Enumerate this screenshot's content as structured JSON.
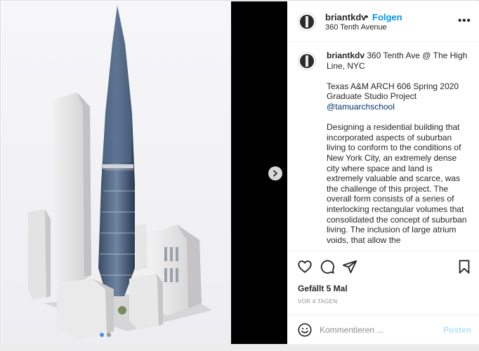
{
  "header": {
    "username": "briantkdv",
    "separator": "•",
    "follow_label": "Folgen",
    "location": "360 Tenth Avenue",
    "more_label": "•••"
  },
  "caption": {
    "username": "briantkdv",
    "line1": " 360 Tenth Ave @ The High Line, NYC",
    "para2": "Texas A&M ARCH 606 Spring 2020 Graduate Studio Project",
    "mention": "@tamuarchschool",
    "para3": "Designing a residential building that incorporated aspects of suburban living to conform to the conditions of New York City, an extremely dense city where space and land is extremely valuable and scarce, was the challenge of this project. The overall form consists of a series of interlocking rectangular volumes that consolidated the concept of suburban living. The inclusion of large atrium voids, that allow the"
  },
  "actions": {
    "likes": "Gefällt 5 Mal",
    "time": "VOR 4 TAGEN"
  },
  "comment": {
    "placeholder": "Kommentieren ...",
    "post_label": "Posten"
  },
  "carousel": {
    "count": 2,
    "active_index": 0
  },
  "colors": {
    "accent": "#0095f6",
    "post_disabled": "#b2dffc",
    "text": "#262626",
    "muted": "#8e8e8e"
  }
}
